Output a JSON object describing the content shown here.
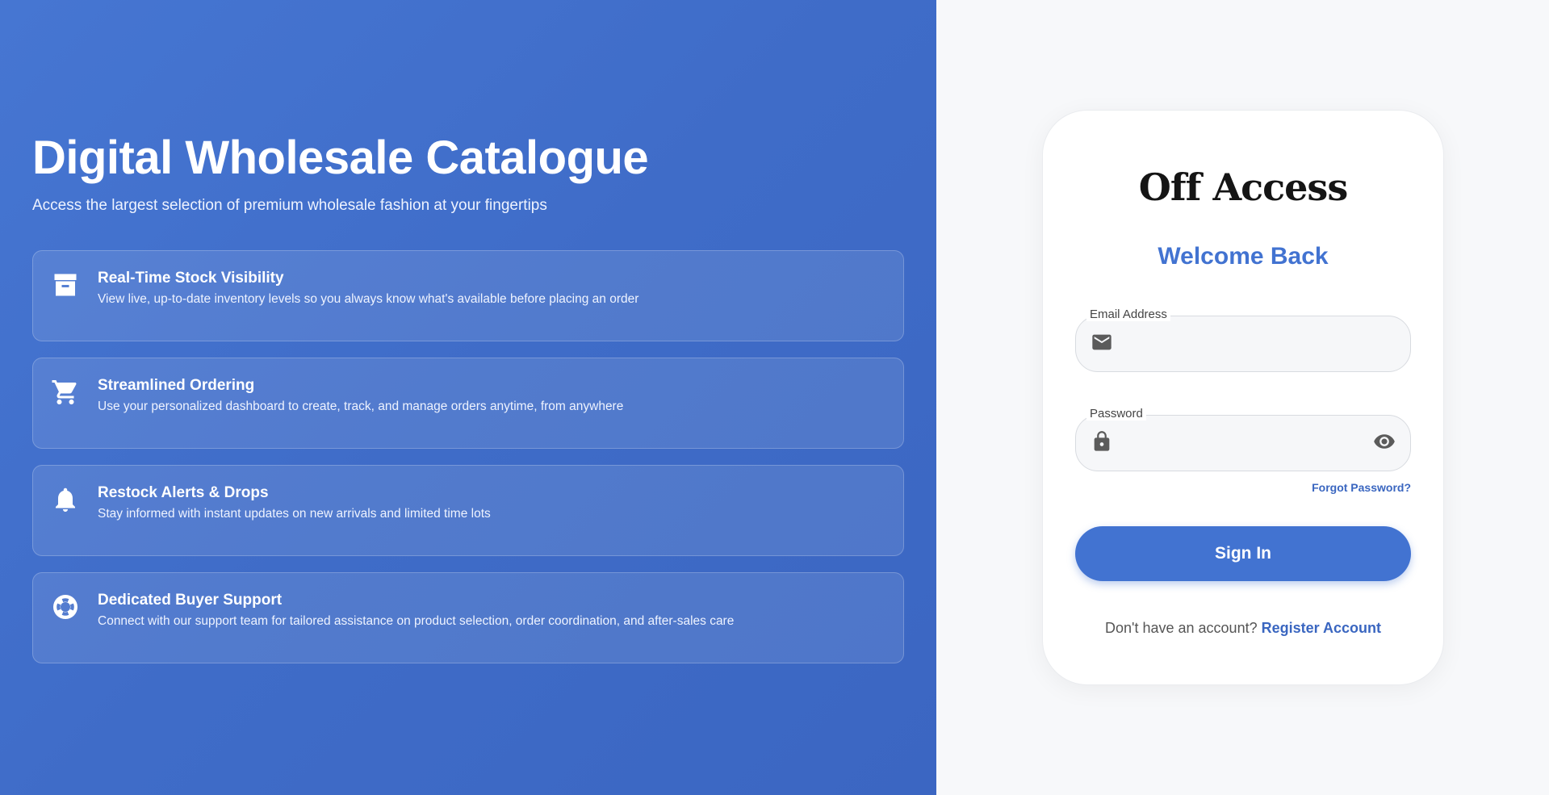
{
  "hero": {
    "title": "Digital Wholesale Catalogue",
    "subtitle": "Access the largest selection of premium wholesale fashion at your fingertips",
    "features": [
      {
        "icon": "archive-box-icon",
        "title": "Real-Time Stock Visibility",
        "desc": "View live, up-to-date inventory levels so you always know what's available before placing an order"
      },
      {
        "icon": "shopping-cart-icon",
        "title": "Streamlined Ordering",
        "desc": "Use your personalized dashboard to create, track, and manage orders anytime, from anywhere"
      },
      {
        "icon": "bell-icon",
        "title": "Restock Alerts & Drops",
        "desc": "Stay informed with instant updates on new arrivals and limited time lots"
      },
      {
        "icon": "lifebuoy-icon",
        "title": "Dedicated Buyer Support",
        "desc": "Connect with our support team for tailored assistance on product selection, order coordination, and after-sales care"
      }
    ]
  },
  "login": {
    "brand": "Off Access",
    "welcome": "Welcome Back",
    "email_label": "Email Address",
    "email_value": "",
    "password_label": "Password",
    "password_value": "",
    "forgot": "Forgot Password?",
    "signin": "Sign In",
    "no_account": "Don't have an account?",
    "register": "Register Account"
  },
  "colors": {
    "accent": "#4273d1",
    "hero_bg": "#4070cc",
    "side_bg": "#f7f8fa"
  }
}
